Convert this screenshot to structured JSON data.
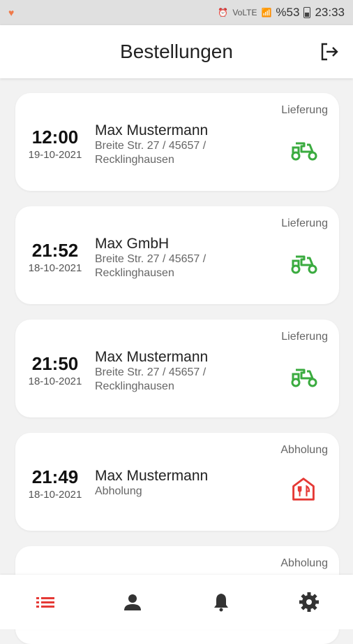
{
  "status_bar": {
    "battery": "%53",
    "time": "23:33"
  },
  "header": {
    "title": "Bestellungen"
  },
  "orders": [
    {
      "time": "12:00",
      "date": "19-10-2021",
      "name": "Max Mustermann",
      "address_line1": "Breite Str. 27 / 45657 /",
      "address_line2": "Recklinghausen",
      "type": "Lieferung",
      "icon": "scooter-icon"
    },
    {
      "time": "21:52",
      "date": "18-10-2021",
      "name": "Max GmbH",
      "address_line1": "Breite Str. 27 / 45657 /",
      "address_line2": "Recklinghausen",
      "type": "Lieferung",
      "icon": "scooter-icon"
    },
    {
      "time": "21:50",
      "date": "18-10-2021",
      "name": "Max Mustermann",
      "address_line1": "Breite Str. 27 / 45657 /",
      "address_line2": "Recklinghausen",
      "type": "Lieferung",
      "icon": "scooter-icon"
    },
    {
      "time": "21:49",
      "date": "18-10-2021",
      "name": "Max Mustermann",
      "address_line1": "Abholung",
      "address_line2": "",
      "type": "Abholung",
      "icon": "restaurant-icon"
    },
    {
      "time": "",
      "date": "",
      "name": "",
      "address_line1": "",
      "address_line2": "",
      "type": "Abholung",
      "icon": ""
    }
  ],
  "bottom_nav": [
    {
      "name": "orders",
      "icon": "list-icon",
      "active": true
    },
    {
      "name": "profile",
      "icon": "person-icon",
      "active": false
    },
    {
      "name": "notifications",
      "icon": "bell-icon",
      "active": false
    },
    {
      "name": "settings",
      "icon": "gear-icon",
      "active": false
    }
  ],
  "colors": {
    "accent": "#e53935",
    "delivery": "#3aab3f",
    "pickup": "#e53935"
  }
}
